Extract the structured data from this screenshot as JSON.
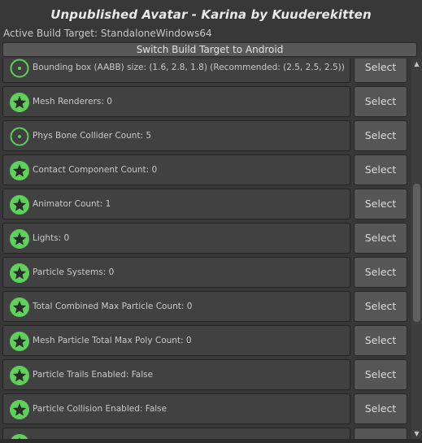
{
  "window": {
    "title": "Unpublished Avatar - Karina by Kuuderekitten",
    "build_target": "Active Build Target: StandaloneWindows64",
    "switch_button": "Switch Build Target to Android"
  },
  "colors": {
    "accent_green": "#5dd15a",
    "icon_dark": "#2b2b2b"
  },
  "rows": [
    {
      "label": "Bounding box (AABB) size: (1.6, 2.8, 1.8) (Recommended: (2.5, 2.5, 2.5))",
      "icon": "ring-icon",
      "action": "Select"
    },
    {
      "label": "Mesh Renderers: 0",
      "icon": "star-icon",
      "action": "Select"
    },
    {
      "label": "Phys Bone Collider Count: 5",
      "icon": "ring-icon",
      "action": "Select"
    },
    {
      "label": "Contact Component Count: 0",
      "icon": "star-icon",
      "action": "Select"
    },
    {
      "label": "Animator Count: 1",
      "icon": "star-icon",
      "action": "Select"
    },
    {
      "label": "Lights: 0",
      "icon": "star-icon",
      "action": "Select"
    },
    {
      "label": "Particle Systems: 0",
      "icon": "star-icon",
      "action": "Select"
    },
    {
      "label": "Total Combined Max Particle Count: 0",
      "icon": "star-icon",
      "action": "Select"
    },
    {
      "label": "Mesh Particle Total Max Poly Count: 0",
      "icon": "star-icon",
      "action": "Select"
    },
    {
      "label": "Particle Trails Enabled: False",
      "icon": "star-icon",
      "action": "Select"
    },
    {
      "label": "Particle Collision Enabled: False",
      "icon": "star-icon",
      "action": "Select"
    },
    {
      "label": "",
      "icon": "star-icon",
      "action": ""
    }
  ],
  "scrollbar": {
    "up_icon": "scroll-up-arrow-icon",
    "down_icon": "scroll-down-arrow-icon"
  }
}
